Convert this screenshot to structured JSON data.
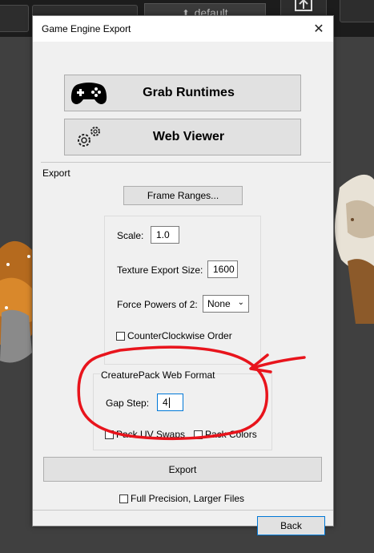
{
  "host": {
    "toolbar_label": "default"
  },
  "dialog": {
    "title": "Game Engine Export",
    "close_symbol": "✕",
    "grab_runtimes_label": "Grab Runtimes",
    "web_viewer_label": "Web Viewer",
    "export_section_label": "Export",
    "frame_ranges_label": "Frame Ranges...",
    "scale_label": "Scale:",
    "scale_value": "1.0",
    "texture_size_label": "Texture Export Size:",
    "texture_size_value": "1600",
    "force_pow2_label": "Force Powers of 2:",
    "force_pow2_value": "None",
    "ccw_label": "CounterClockwise Order",
    "creaturepack_label": "CreaturePack Web Format",
    "gap_step_label": "Gap Step:",
    "gap_step_value": "4",
    "pack_uv_label": "Pack UV Swaps",
    "pack_colors_label": "Pack Colors",
    "export_button_label": "Export",
    "full_precision_label": "Full Precision, Larger Files",
    "back_label": "Back"
  },
  "colors": {
    "annotation": "#e8141c",
    "dialog_bg": "#f0f0f0",
    "button_bg": "#e1e1e1"
  },
  "icons": [
    "gamepad-icon",
    "gears-icon",
    "close-icon",
    "chevron-down-icon"
  ]
}
